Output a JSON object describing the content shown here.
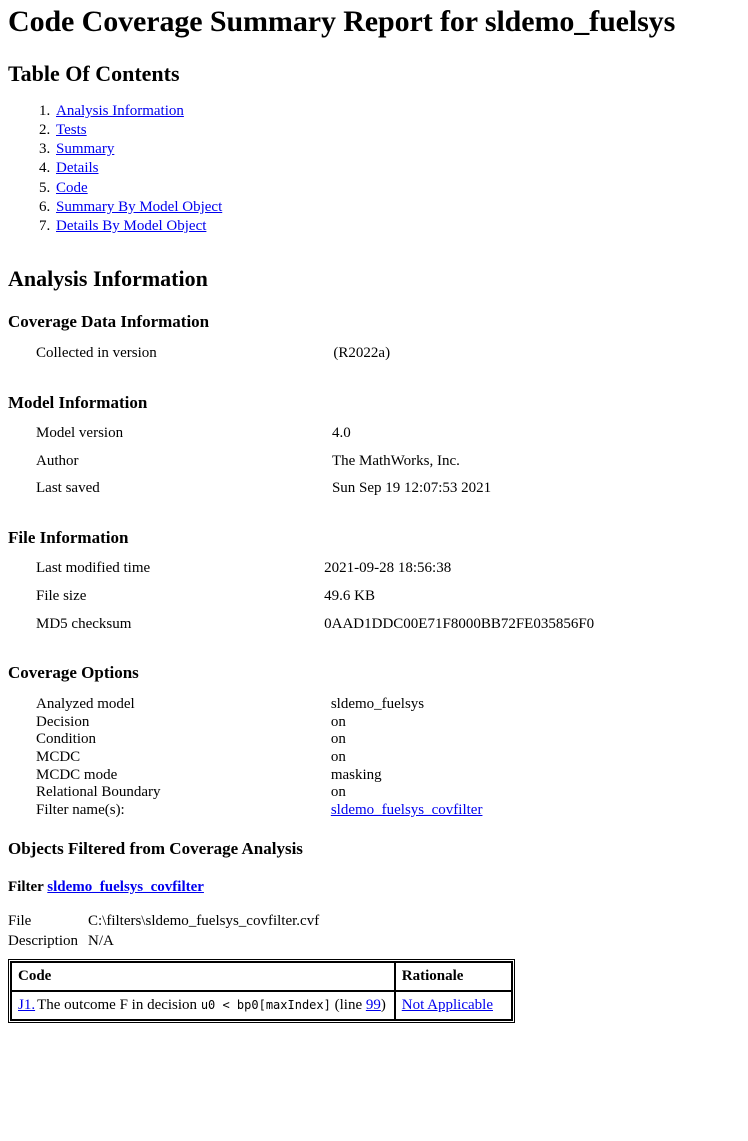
{
  "report": {
    "title": "Code Coverage Summary Report for sldemo_fuelsys"
  },
  "toc": {
    "heading": "Table Of Contents",
    "items": [
      {
        "label": "Analysis Information"
      },
      {
        "label": "Tests"
      },
      {
        "label": "Summary"
      },
      {
        "label": "Details"
      },
      {
        "label": "Code"
      },
      {
        "label": "Summary By Model Object"
      },
      {
        "label": "Details By Model Object"
      }
    ]
  },
  "analysis": {
    "heading": "Analysis Information",
    "coverage_data": {
      "heading": "Coverage Data Information",
      "rows": [
        {
          "key": "Collected in version",
          "value": "(R2022a)"
        }
      ]
    },
    "model_info": {
      "heading": "Model Information",
      "rows": [
        {
          "key": "Model version",
          "value": "4.0"
        },
        {
          "key": "Author",
          "value": "The MathWorks, Inc."
        },
        {
          "key": "Last saved",
          "value": "Sun Sep 19 12:07:53 2021"
        }
      ]
    },
    "file_info": {
      "heading": "File Information",
      "rows": [
        {
          "key": "Last modified time",
          "value": "2021-09-28 18:56:38"
        },
        {
          "key": "File size",
          "value": "49.6 KB"
        },
        {
          "key": "MD5 checksum",
          "value": "0AAD1DDC00E71F8000BB72FE035856F0"
        }
      ]
    },
    "coverage_options": {
      "heading": "Coverage Options",
      "rows": [
        {
          "key": "Analyzed model",
          "value": "sldemo_fuelsys"
        },
        {
          "key": "Decision",
          "value": "on"
        },
        {
          "key": "Condition",
          "value": "on"
        },
        {
          "key": "MCDC",
          "value": "on"
        },
        {
          "key": "MCDC mode",
          "value": "masking"
        },
        {
          "key": "Relational Boundary",
          "value": "on"
        }
      ],
      "filter_names_key": "Filter name(s):",
      "filter_names_value": "sldemo_fuelsys_covfilter"
    }
  },
  "filtered": {
    "heading": "Objects Filtered from Coverage Analysis",
    "filter_label": "Filter",
    "filter_link": "sldemo_fuelsys_covfilter",
    "file_key": "File",
    "file_value": "C:\\filters\\sldemo_fuelsys_covfilter.cvf",
    "description_key": "Description",
    "description_value": "N/A",
    "table": {
      "columns": [
        "Code",
        "Rationale"
      ],
      "rows": [
        {
          "id": "J1.",
          "text_before": "The outcome F in decision",
          "code": "u0 < bp0[maxIndex]",
          "line_prefix": "(line",
          "line_number": "99",
          "line_suffix": ")",
          "rationale": "Not Applicable"
        }
      ]
    }
  },
  "colors": {
    "link": "#0000EE",
    "text": "#000000",
    "background": "#FFFFFF",
    "table_border": "#000000"
  }
}
